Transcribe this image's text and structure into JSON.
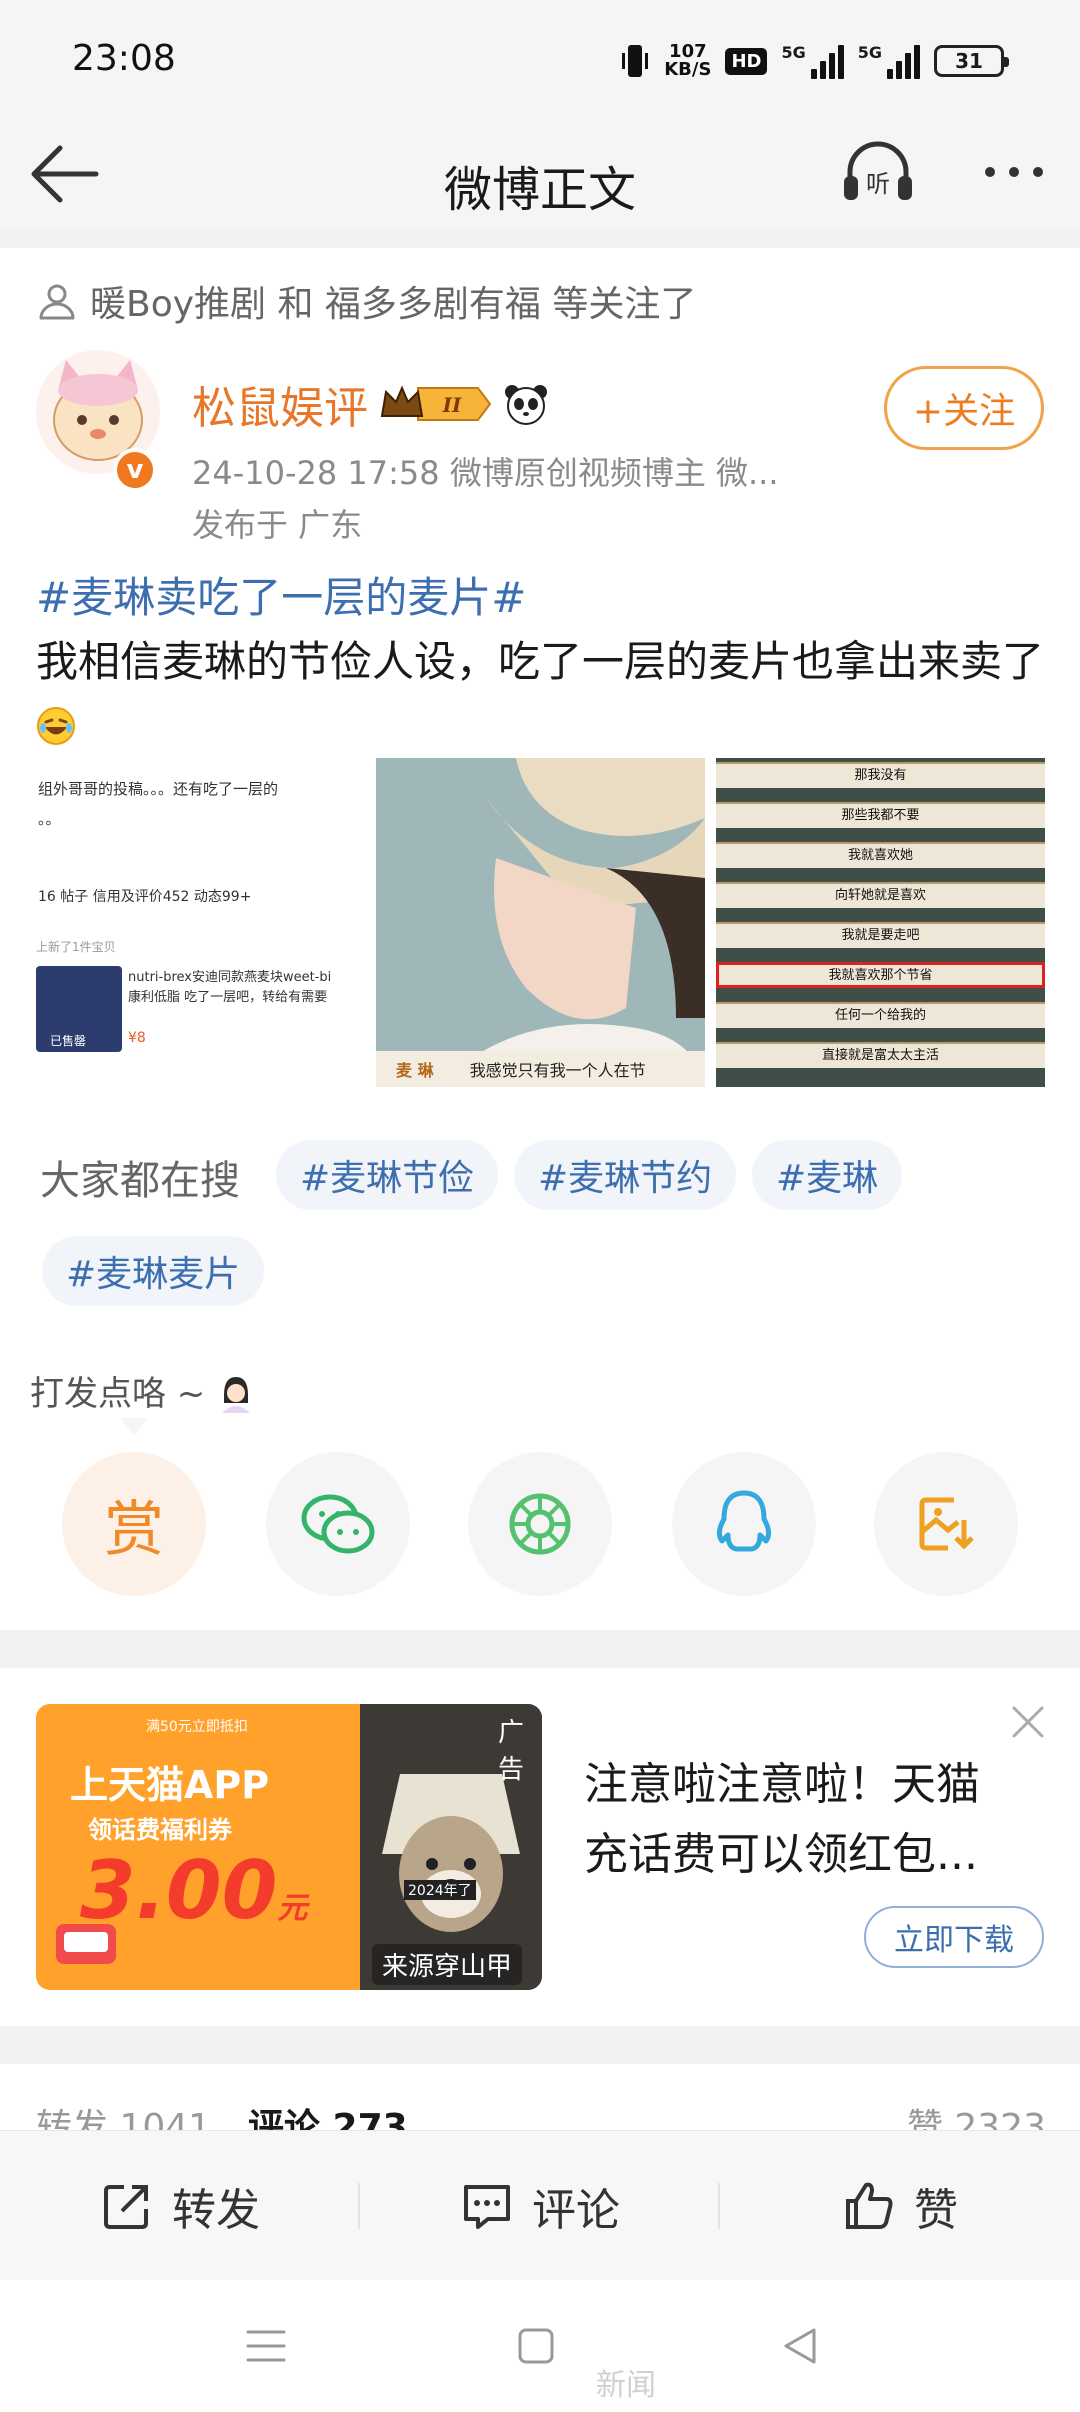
{
  "status_bar": {
    "time": "23:08",
    "speed_value": "107",
    "speed_unit": "KB/S",
    "hd_label": "HD",
    "signal1_label": "5G",
    "signal2_label": "5G",
    "battery": "31"
  },
  "nav": {
    "title": "微博正文",
    "listen_label": "听"
  },
  "post": {
    "followed_by": "暖Boy推剧 和 福多多剧有福 等关注了",
    "author": "松鼠娱评",
    "rank_label": "II",
    "verified_mark": "v",
    "meta": "24-10-28 17:58  微博原创视频博主 微...",
    "location": "发布于 广东",
    "follow_label": "+关注",
    "hashtag": "#麦琳卖吃了一层的麦片#",
    "text": "我相信麦琳的节俭人设，吃了一层的麦片也拿出来卖了"
  },
  "images": {
    "img1": {
      "line1": "组外哥哥的投稿。。。还有吃了一层的",
      "line2": "。。",
      "stats": "16   帖子   信用及评价452    动态99+",
      "new_item": "上新了1件宝贝",
      "product": "nutri-brex安迪同款燕麦块weet-bi",
      "product2": "康利低脂 吃了一层吧，转给有需要",
      "sold": "已售罄",
      "price": "¥8"
    },
    "img2": {
      "name": "麦 琳",
      "caption": "我感觉只有我一个人在节"
    },
    "img3": {
      "subs": [
        "那我没有",
        "那些我都不要",
        "我就喜欢她",
        "向轩她就是喜欢",
        "我就是要走吧",
        "我就喜欢那个节省",
        "任何一个给我的",
        "直接就是富太太主活"
      ]
    }
  },
  "search": {
    "label": "大家都在搜",
    "tags": [
      "#麦琳节俭",
      "#麦琳节约",
      "#麦琳",
      "#麦琳麦片"
    ]
  },
  "tip": {
    "text": "打发点咯 ~",
    "reward_label": "赏"
  },
  "ad": {
    "top_line": "满50元立即抵扣",
    "title": "上天猫APP",
    "subtitle": "领话费福利券",
    "amount": "3.00",
    "amount_unit": "元",
    "photo_caption": "2024年了",
    "tag": "广告",
    "source": "来源穿山甲",
    "text": "注意啦注意啦！天猫充话费可以领红包...",
    "button": "立即下载"
  },
  "stats": {
    "repost": "转发 1041",
    "comment": "评论 273",
    "like": "赞 2323"
  },
  "actions": {
    "repost": "转发",
    "comment": "评论",
    "like": "赞"
  },
  "watermark": "新闻"
}
